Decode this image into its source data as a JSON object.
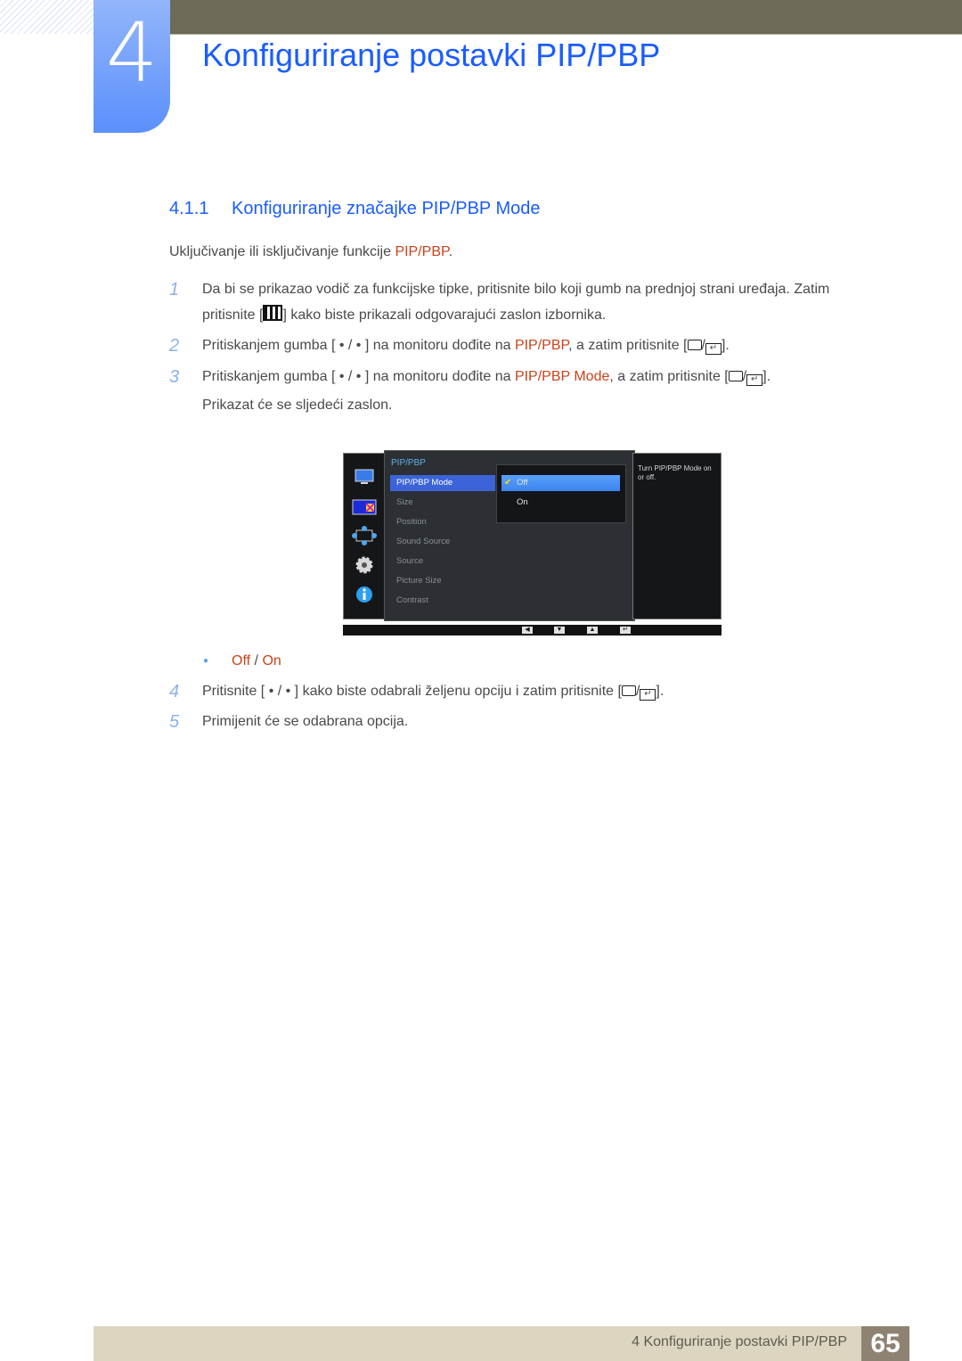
{
  "chapter": {
    "number": "4",
    "title": "Konfiguriranje postavki PIP/PBP"
  },
  "section": {
    "number": "4.1.1",
    "title": "Konfiguriranje značajke PIP/PBP Mode"
  },
  "intro": {
    "text": "Uključivanje ili isključivanje funkcije ",
    "highlight": "PIP/PBP",
    "end": "."
  },
  "steps": [
    {
      "n": "1",
      "a": "Da bi se prikazao vodič za funkcijske tipke, pritisnite bilo koji gumb na prednjoj strani uređaja. Zatim",
      "b": "pritisnite [",
      "c": "] kako biste prikazali odgovarajući zaslon izbornika."
    },
    {
      "n": "2",
      "a": "Pritiskanjem gumba [ • / • ] na monitoru dođite na ",
      "hl": "PIP/PBP",
      "b": ", a zatim pritisnite [",
      "c": "]."
    },
    {
      "n": "3",
      "a": "Pritiskanjem gumba [ • / • ] na monitoru dođite na ",
      "hl": "PIP/PBP Mode",
      "b": ", a zatim pritisnite [",
      "c": "].",
      "d": "Prikazat će se sljedeći zaslon."
    },
    {
      "n": "4",
      "a": "Pritisnite [ • / • ] kako biste odabrali željenu opciju i zatim pritisnite [",
      "c": "]."
    },
    {
      "n": "5",
      "a": "Primijenit će se odabrana opcija."
    }
  ],
  "osd": {
    "menu_title": "PIP/PBP",
    "items": [
      "PIP/PBP Mode",
      "Size",
      "Position",
      "Sound Source",
      "Source",
      "Picture Size",
      "Contrast"
    ],
    "selected_item": "PIP/PBP Mode",
    "options": [
      "Off",
      "On"
    ],
    "selected_option": "Off",
    "help": "Turn PIP/PBP Mode on or off.",
    "sidebar_icons": [
      "monitor-icon",
      "pip-icon",
      "position-arrows-icon",
      "gear-icon",
      "info-icon"
    ],
    "keys": [
      "◀",
      "▼",
      "▲",
      "↵"
    ]
  },
  "options_line": {
    "off": "Off",
    "sep": " / ",
    "on": "On"
  },
  "footer": {
    "text": "4 Konfiguriranje postavki PIP/PBP",
    "page": "65"
  }
}
